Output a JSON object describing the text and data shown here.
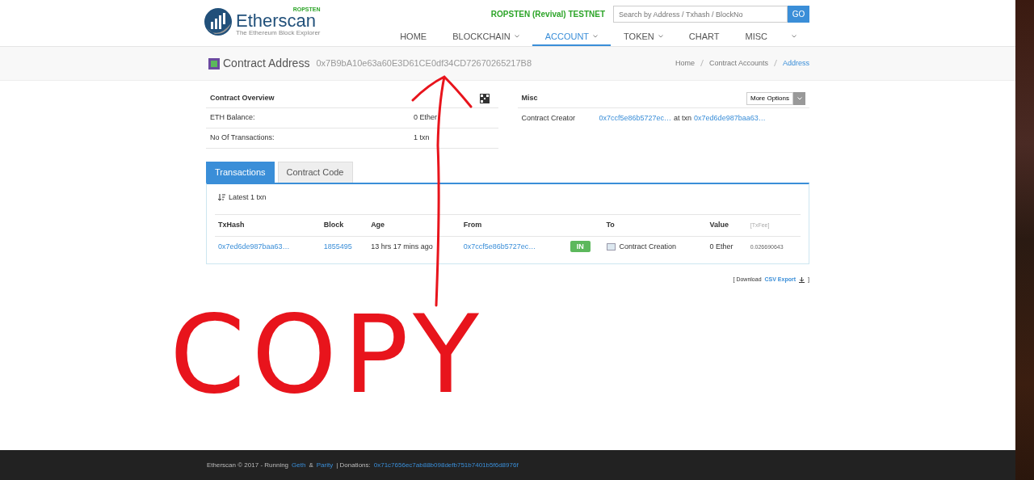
{
  "header": {
    "logo": {
      "name": "Etherscan",
      "tagline": "The Ethereum Block Explorer",
      "network_badge": "ROPSTEN"
    },
    "network": "ROPSTEN (Revival) TESTNET",
    "search": {
      "placeholder": "Search by Address / Txhash / BlockNo",
      "button": "GO"
    },
    "nav": [
      {
        "label": "HOME",
        "selected": false,
        "dropdown": false
      },
      {
        "label": "BLOCKCHAIN",
        "selected": false,
        "dropdown": true
      },
      {
        "label": "ACCOUNT",
        "selected": true,
        "dropdown": true
      },
      {
        "label": "TOKEN",
        "selected": false,
        "dropdown": true
      },
      {
        "label": "CHART",
        "selected": false,
        "dropdown": false
      },
      {
        "label": "MISC",
        "selected": false,
        "dropdown": true
      }
    ]
  },
  "page_title": {
    "title": "Contract Address",
    "address": "0x7B9bA10e63a60E3D61CE0df34CD72670265217B8"
  },
  "breadcrumb": [
    {
      "label": "Home",
      "selected": false
    },
    {
      "label": "Contract Accounts",
      "selected": false
    },
    {
      "label": "Address",
      "selected": true
    }
  ],
  "overview": {
    "title": "Contract Overview",
    "rows": [
      {
        "label": "ETH Balance:",
        "value": "0 Ether"
      },
      {
        "label": "No Of Transactions:",
        "value": "1 txn"
      }
    ]
  },
  "misc": {
    "title": "Misc",
    "button": "More Options",
    "creator_label": "Contract Creator",
    "creator": "0x7ccf5e86b5727ec…",
    "at_txn": "at txn",
    "txn": "0x7ed6de987baa63…"
  },
  "tabs": [
    {
      "label": "Transactions",
      "selected": true
    },
    {
      "label": "Contract Code",
      "selected": false
    }
  ],
  "transactions": {
    "summary": "Latest 1 txn",
    "columns": [
      "TxHash",
      "Block",
      "Age",
      "From",
      "To",
      "Value",
      "[TxFee]"
    ],
    "rows": [
      {
        "txhash": "0x7ed6de987baa63…",
        "block": "1855495",
        "age": "13 hrs 17 mins ago",
        "from": "0x7ccf5e86b5727ec…",
        "direction": "IN",
        "to": "Contract Creation",
        "value": "0 Ether",
        "fee": "0.026690643"
      }
    ]
  },
  "export": {
    "prefix": "[ Download",
    "link": "CSV Export",
    "suffix": "]"
  },
  "footer": {
    "text": "Etherscan © 2017 - Running",
    "link_1": "Geth",
    "and": "&",
    "link_2": "Parity",
    "separator": "| Donations:",
    "donation": "0x71c7656ec7ab88b098defb751b7401b5f6d8976f"
  },
  "annotation": {
    "text": "COPY"
  }
}
